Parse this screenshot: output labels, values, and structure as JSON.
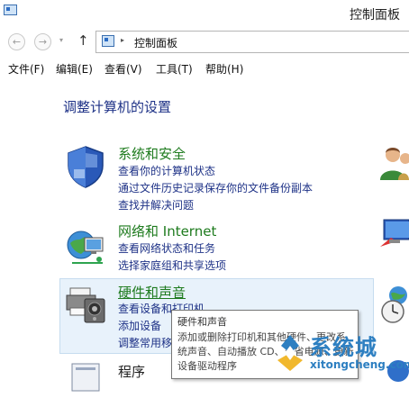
{
  "window": {
    "title": "控制面板"
  },
  "nav": {
    "back": "←",
    "forward": "→",
    "dropdown": "▾",
    "up": "↑",
    "breadcrumb_sep": "▸",
    "address": "控制面板"
  },
  "menu": [
    "文件(F)",
    "编辑(E)",
    "查看(V)",
    "工具(T)",
    "帮助(H)"
  ],
  "heading": "调整计算机的设置",
  "categories": [
    {
      "title": "系统和安全",
      "links": [
        "查看你的计算机状态",
        "通过文件历史记录保存你的文件备份副本",
        "查找并解决问题"
      ]
    },
    {
      "title": "网络和 Internet",
      "links": [
        "查看网络状态和任务",
        "选择家庭组和共享选项"
      ]
    },
    {
      "title": "硬件和声音",
      "links": [
        "查看设备和打印机",
        "添加设备",
        "调整常用移"
      ]
    },
    {
      "title": "程序"
    }
  ],
  "tooltip": {
    "title": "硬件和声音",
    "body": "添加或删除打印机和其他硬件、更改系统声音、自动播放 CD、节省电源、更新设备驱动程序"
  },
  "watermark": {
    "brand": "系统城",
    "url": "xitongcheng.com"
  }
}
